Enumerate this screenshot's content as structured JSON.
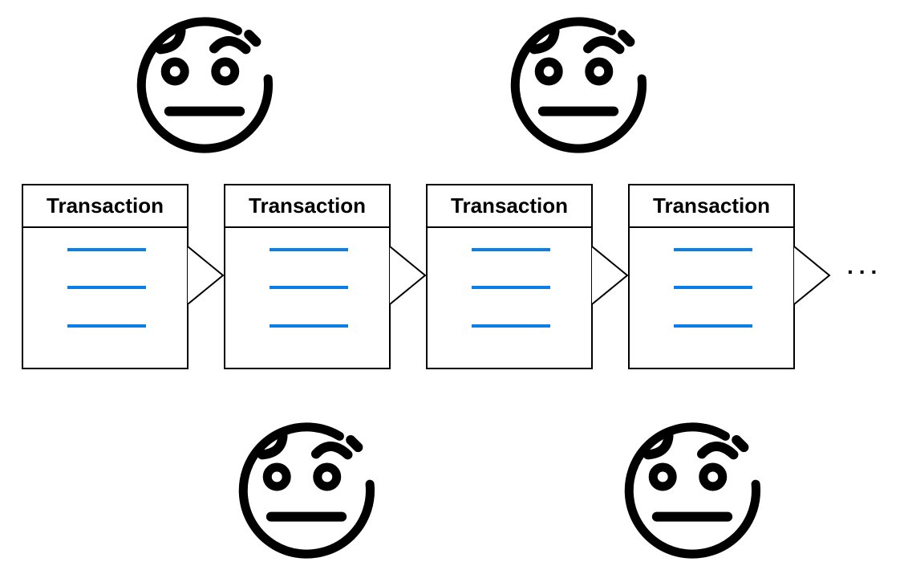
{
  "diagram": {
    "transactions": [
      {
        "label": "Transaction",
        "field_lines": 3
      },
      {
        "label": "Transaction",
        "field_lines": 3
      },
      {
        "label": "Transaction",
        "field_lines": 3
      },
      {
        "label": "Transaction",
        "field_lines": 3
      }
    ],
    "continuation": "...",
    "faces": [
      {
        "icon": "worried-face-icon",
        "position": "above transaction 1"
      },
      {
        "icon": "worried-face-icon",
        "position": "above transaction 3"
      },
      {
        "icon": "worried-face-icon",
        "position": "below transaction 2"
      },
      {
        "icon": "worried-face-icon",
        "position": "below transaction 4"
      }
    ],
    "colors": {
      "line_accent": "#0a7fe8",
      "stroke": "#000000",
      "background": "#ffffff"
    }
  }
}
